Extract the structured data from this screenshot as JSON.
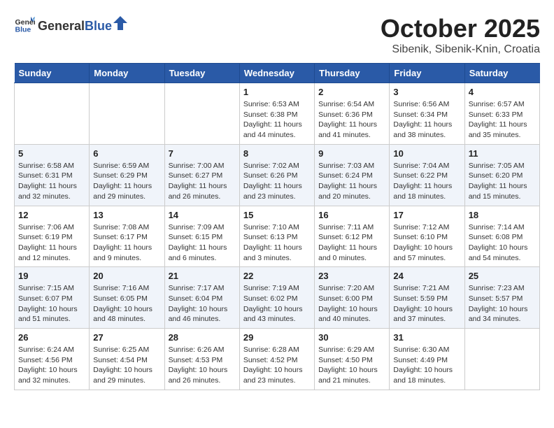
{
  "header": {
    "logo_general": "General",
    "logo_blue": "Blue",
    "title": "October 2025",
    "subtitle": "Sibenik, Sibenik-Knin, Croatia"
  },
  "calendar": {
    "days_of_week": [
      "Sunday",
      "Monday",
      "Tuesday",
      "Wednesday",
      "Thursday",
      "Friday",
      "Saturday"
    ],
    "weeks": [
      [
        {
          "day": "",
          "info": ""
        },
        {
          "day": "",
          "info": ""
        },
        {
          "day": "",
          "info": ""
        },
        {
          "day": "1",
          "info": "Sunrise: 6:53 AM\nSunset: 6:38 PM\nDaylight: 11 hours and 44 minutes."
        },
        {
          "day": "2",
          "info": "Sunrise: 6:54 AM\nSunset: 6:36 PM\nDaylight: 11 hours and 41 minutes."
        },
        {
          "day": "3",
          "info": "Sunrise: 6:56 AM\nSunset: 6:34 PM\nDaylight: 11 hours and 38 minutes."
        },
        {
          "day": "4",
          "info": "Sunrise: 6:57 AM\nSunset: 6:33 PM\nDaylight: 11 hours and 35 minutes."
        }
      ],
      [
        {
          "day": "5",
          "info": "Sunrise: 6:58 AM\nSunset: 6:31 PM\nDaylight: 11 hours and 32 minutes."
        },
        {
          "day": "6",
          "info": "Sunrise: 6:59 AM\nSunset: 6:29 PM\nDaylight: 11 hours and 29 minutes."
        },
        {
          "day": "7",
          "info": "Sunrise: 7:00 AM\nSunset: 6:27 PM\nDaylight: 11 hours and 26 minutes."
        },
        {
          "day": "8",
          "info": "Sunrise: 7:02 AM\nSunset: 6:26 PM\nDaylight: 11 hours and 23 minutes."
        },
        {
          "day": "9",
          "info": "Sunrise: 7:03 AM\nSunset: 6:24 PM\nDaylight: 11 hours and 20 minutes."
        },
        {
          "day": "10",
          "info": "Sunrise: 7:04 AM\nSunset: 6:22 PM\nDaylight: 11 hours and 18 minutes."
        },
        {
          "day": "11",
          "info": "Sunrise: 7:05 AM\nSunset: 6:20 PM\nDaylight: 11 hours and 15 minutes."
        }
      ],
      [
        {
          "day": "12",
          "info": "Sunrise: 7:06 AM\nSunset: 6:19 PM\nDaylight: 11 hours and 12 minutes."
        },
        {
          "day": "13",
          "info": "Sunrise: 7:08 AM\nSunset: 6:17 PM\nDaylight: 11 hours and 9 minutes."
        },
        {
          "day": "14",
          "info": "Sunrise: 7:09 AM\nSunset: 6:15 PM\nDaylight: 11 hours and 6 minutes."
        },
        {
          "day": "15",
          "info": "Sunrise: 7:10 AM\nSunset: 6:13 PM\nDaylight: 11 hours and 3 minutes."
        },
        {
          "day": "16",
          "info": "Sunrise: 7:11 AM\nSunset: 6:12 PM\nDaylight: 11 hours and 0 minutes."
        },
        {
          "day": "17",
          "info": "Sunrise: 7:12 AM\nSunset: 6:10 PM\nDaylight: 10 hours and 57 minutes."
        },
        {
          "day": "18",
          "info": "Sunrise: 7:14 AM\nSunset: 6:08 PM\nDaylight: 10 hours and 54 minutes."
        }
      ],
      [
        {
          "day": "19",
          "info": "Sunrise: 7:15 AM\nSunset: 6:07 PM\nDaylight: 10 hours and 51 minutes."
        },
        {
          "day": "20",
          "info": "Sunrise: 7:16 AM\nSunset: 6:05 PM\nDaylight: 10 hours and 48 minutes."
        },
        {
          "day": "21",
          "info": "Sunrise: 7:17 AM\nSunset: 6:04 PM\nDaylight: 10 hours and 46 minutes."
        },
        {
          "day": "22",
          "info": "Sunrise: 7:19 AM\nSunset: 6:02 PM\nDaylight: 10 hours and 43 minutes."
        },
        {
          "day": "23",
          "info": "Sunrise: 7:20 AM\nSunset: 6:00 PM\nDaylight: 10 hours and 40 minutes."
        },
        {
          "day": "24",
          "info": "Sunrise: 7:21 AM\nSunset: 5:59 PM\nDaylight: 10 hours and 37 minutes."
        },
        {
          "day": "25",
          "info": "Sunrise: 7:23 AM\nSunset: 5:57 PM\nDaylight: 10 hours and 34 minutes."
        }
      ],
      [
        {
          "day": "26",
          "info": "Sunrise: 6:24 AM\nSunset: 4:56 PM\nDaylight: 10 hours and 32 minutes."
        },
        {
          "day": "27",
          "info": "Sunrise: 6:25 AM\nSunset: 4:54 PM\nDaylight: 10 hours and 29 minutes."
        },
        {
          "day": "28",
          "info": "Sunrise: 6:26 AM\nSunset: 4:53 PM\nDaylight: 10 hours and 26 minutes."
        },
        {
          "day": "29",
          "info": "Sunrise: 6:28 AM\nSunset: 4:52 PM\nDaylight: 10 hours and 23 minutes."
        },
        {
          "day": "30",
          "info": "Sunrise: 6:29 AM\nSunset: 4:50 PM\nDaylight: 10 hours and 21 minutes."
        },
        {
          "day": "31",
          "info": "Sunrise: 6:30 AM\nSunset: 4:49 PM\nDaylight: 10 hours and 18 minutes."
        },
        {
          "day": "",
          "info": ""
        }
      ]
    ]
  }
}
